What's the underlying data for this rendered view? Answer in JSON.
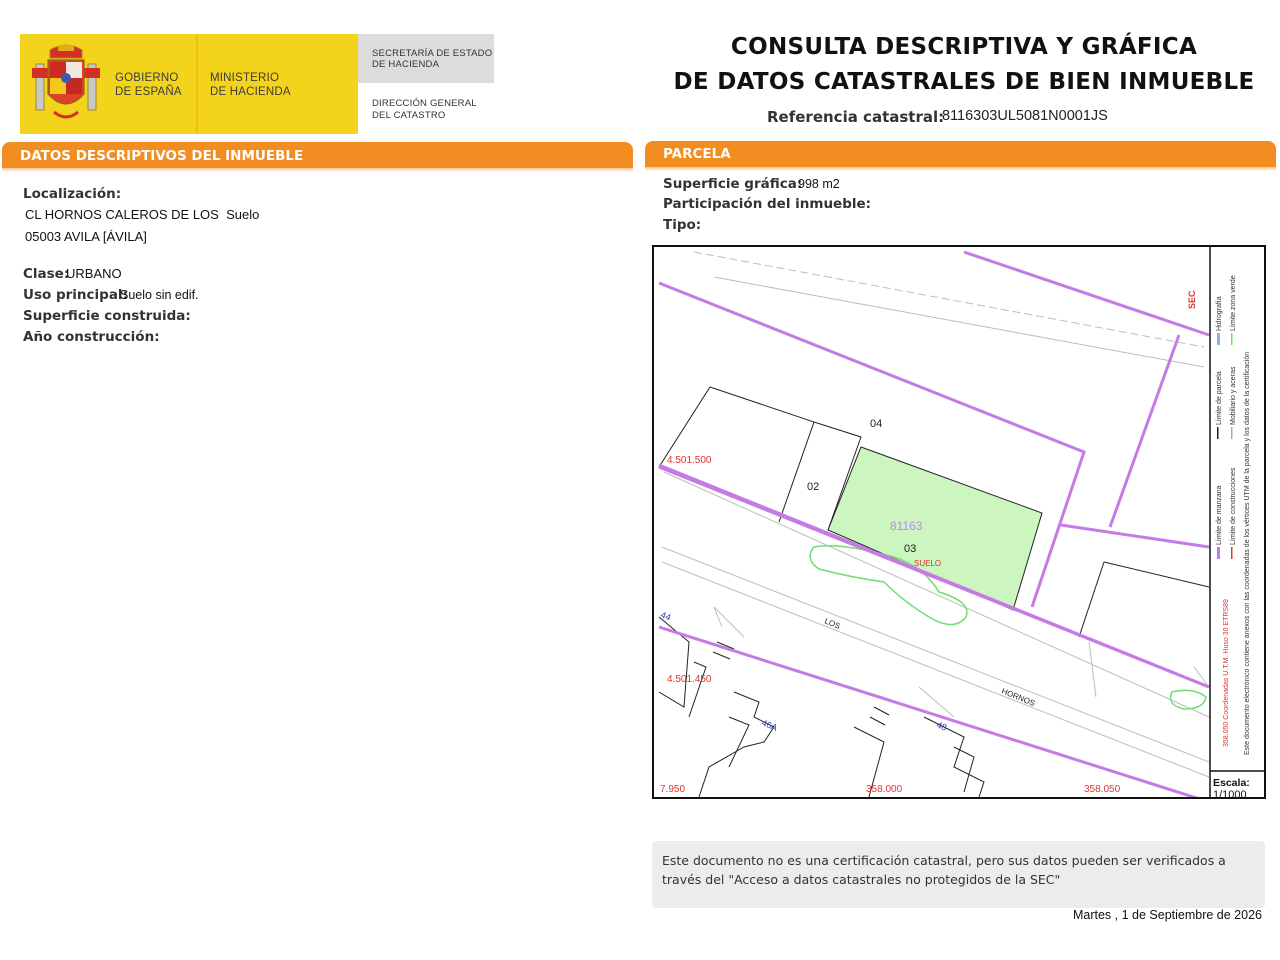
{
  "header": {
    "government_line1": "GOBIERNO",
    "government_line2": "DE ESPAÑA",
    "ministry_line1": "MINISTERIO",
    "ministry_line2": "DE HACIENDA",
    "secretariat_line1": "SECRETARÍA DE ESTADO",
    "secretariat_line2": "DE HACIENDA",
    "directorate_line1": "DIRECCIÓN GENERAL",
    "directorate_line2": "DEL CATASTRO",
    "brand_yellow": "#f4d31c"
  },
  "title": {
    "line1": "CONSULTA DESCRIPTIVA Y GRÁFICA",
    "line2": "DE DATOS CATASTRALES DE BIEN INMUEBLE",
    "reference_label": "Referencia catastral:",
    "reference_value": "8116303UL5081N0001JS"
  },
  "descriptive": {
    "header": "DATOS DESCRIPTIVOS DEL INMUEBLE",
    "location_label": "Localización:",
    "location_line1": "CL HORNOS CALEROS DE LOS  Suelo",
    "location_line2": "05003 AVILA [ÁVILA]",
    "class_label": "Clase:",
    "class_value": "URBANO",
    "use_label": "Uso principal:",
    "use_value": "Suelo sin edif.",
    "built_area_label": "Superficie construida:",
    "year_label": "Año construcción:"
  },
  "parcel": {
    "header": "PARCELA",
    "graphic_area_label": "Superficie gráfica:",
    "graphic_area_value": "998 m2",
    "participation_label": "Participación del inmueble:",
    "type_label": "Tipo:",
    "accent_color": "#f28d21"
  },
  "map": {
    "coord_y1": "4.501.500",
    "coord_y2": "4.501.450",
    "coord_x1": "7.950",
    "coord_x2": "358.000",
    "coord_x3": "358.050",
    "parcel_id": "81163",
    "label_02": "02",
    "label_03": "03",
    "label_04": "04",
    "suelo": "SUELO",
    "street_los": "LOS",
    "street_hornos": "HORNOS",
    "num_44": "44",
    "num_46a": "46A",
    "num_48": "48",
    "scale_label": "Escala:",
    "scale_value": "1/1000",
    "logo_mark": "SEC",
    "legend_coords": "358.050 Coordenadas U.T.M. Huso 30 ETRS89",
    "legend_manzana": "Límite de manzana",
    "legend_parcela": "Límite de parcela",
    "legend_hidrografia": "Hidrografía",
    "legend_construcciones": "Límite de construcciones",
    "legend_mobiliario": "Mobiliario y aceras",
    "legend_zona_verde": "Límite zona verde",
    "legend_note": "Este documento electrónico contiene anexos con las coordenadas de los vértices UTM de la parcela y los datos de la certificación",
    "parcel_fill": "#ccf5c0",
    "boundary_color": "#c57be6",
    "coord_color": "#e0332e"
  },
  "footer": {
    "notice": "Este documento no es una certificación catastral, pero sus datos pueden ser verificados a través del \"Acceso a datos catastrales no protegidos de la SEC\"",
    "date": "Martes , 1 de Septiembre de 2026"
  }
}
